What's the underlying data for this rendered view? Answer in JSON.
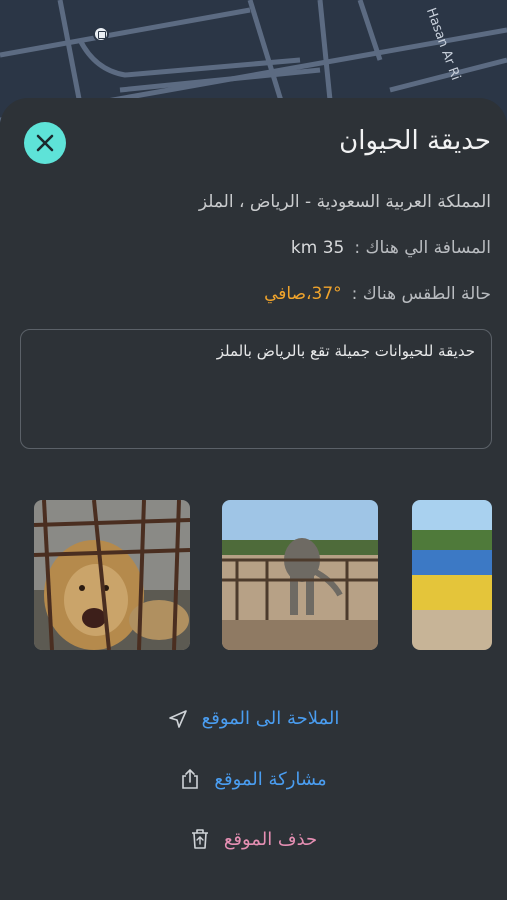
{
  "map": {
    "street_name": "Hasan Ar Ri"
  },
  "place": {
    "title": "حديقة الحيوان",
    "address": "المملكة العربية السعودية - الرياض ، الملز",
    "distance_label": "المسافة الي هناك :",
    "distance_value": "km  35",
    "weather_label": "حالة الطقس هناك :",
    "weather_value": "37°،صافي",
    "description": "حديقة للحيوانات جميلة تقع بالرياض بالملز"
  },
  "actions": {
    "navigate_label": "الملاحة الى الموقع",
    "share_label": "مشاركة الموقع",
    "delete_label": "حذف الموقع"
  },
  "colors": {
    "close_button": "#5ee3d8",
    "link_blue": "#4a9df0",
    "delete_pink": "#e58fb3",
    "weather_orange": "#f0a42c",
    "sheet_bg": "#2d3237"
  },
  "icons": {
    "close": "close-icon",
    "navigate": "navigation-arrow-icon",
    "share": "share-icon",
    "delete": "trash-icon"
  }
}
